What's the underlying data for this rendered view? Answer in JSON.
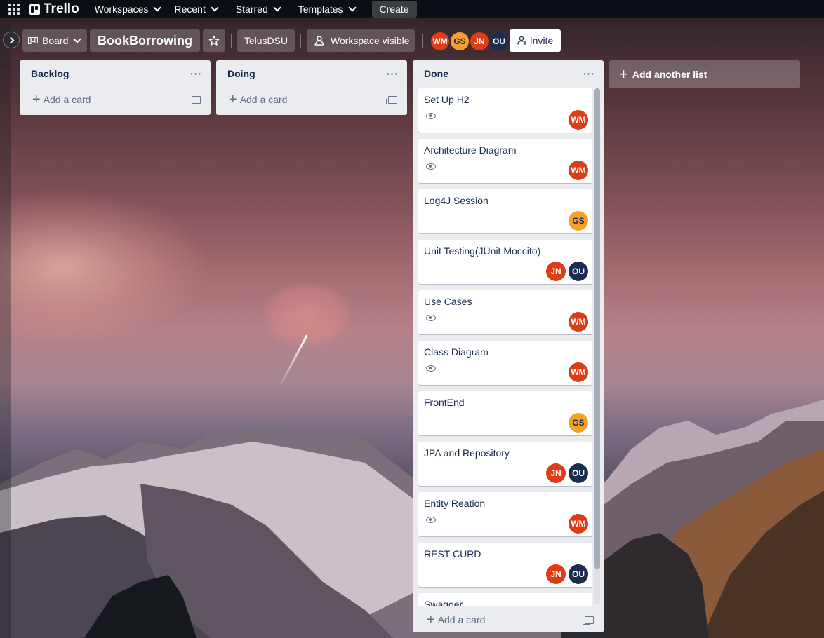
{
  "nav": {
    "brand": "Trello",
    "items": [
      "Workspaces",
      "Recent",
      "Starred",
      "Templates"
    ],
    "create_label": "Create"
  },
  "board": {
    "view_label": "Board",
    "title": "BookBorrowing",
    "workspace": "TelusDSU",
    "visibility": "Workspace visible",
    "invite_label": "Invite",
    "members": [
      {
        "initials": "WM",
        "color": "#dd3d16"
      },
      {
        "initials": "GS",
        "color": "#f5a02a"
      },
      {
        "initials": "JN",
        "color": "#df3b14"
      },
      {
        "initials": "OU",
        "color": "#1b2e4f"
      }
    ]
  },
  "lists": {
    "backlog": {
      "title": "Backlog",
      "add_card": "Add a card"
    },
    "doing": {
      "title": "Doing",
      "add_card": "Add a card"
    },
    "done": {
      "title": "Done",
      "add_card": "Add a card",
      "cards": [
        {
          "title": "Set Up H2"
        },
        {
          "title": "Architecture Diagram"
        },
        {
          "title": "Log4J Session"
        },
        {
          "title": "Unit Testing(JUnit Moccito)"
        },
        {
          "title": "Use Cases"
        },
        {
          "title": "Class Diagram"
        },
        {
          "title": "FrontEnd"
        },
        {
          "title": "JPA and Repository"
        },
        {
          "title": "Entity Reation"
        },
        {
          "title": "REST CURD"
        },
        {
          "title": "Swagger"
        }
      ]
    }
  },
  "add_list_label": "Add another list",
  "avatar_labels": {
    "wm": "WM",
    "gs": "GS",
    "jn": "JN",
    "ou": "OU"
  },
  "icons": [
    "apps-grid-icon",
    "trello-logo-icon",
    "chevron-down-icon",
    "star-icon",
    "people-icon",
    "add-person-icon",
    "more-dots-icon",
    "plus-icon",
    "template-icon",
    "eye-icon",
    "chevron-right-icon"
  ]
}
